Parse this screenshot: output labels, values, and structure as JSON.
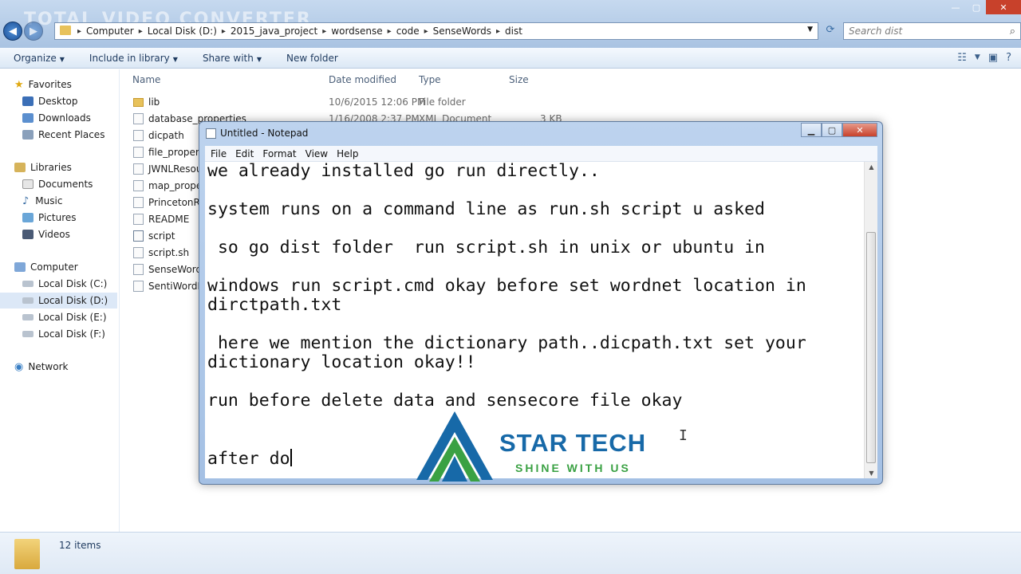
{
  "window": {
    "watermark": "TOTAL VIDEO CONVERTER",
    "controls": [
      "—",
      "▢",
      "✕"
    ]
  },
  "address_bar": {
    "segments": [
      "Computer",
      "Local Disk (D:)",
      "2015_java_project",
      "wordsense",
      "code",
      "SenseWords",
      "dist"
    ],
    "search_placeholder": "Search dist"
  },
  "toolbar": {
    "organize": "Organize",
    "include_in_library": "Include in library",
    "share_with": "Share with",
    "new_folder": "New folder"
  },
  "sidebar": {
    "favorites": "Favorites",
    "desktop": "Desktop",
    "downloads": "Downloads",
    "recent_places": "Recent Places",
    "libraries": "Libraries",
    "documents": "Documents",
    "music": "Music",
    "pictures": "Pictures",
    "videos": "Videos",
    "computer": "Computer",
    "local_c": "Local Disk (C:)",
    "local_d": "Local Disk (D:)",
    "local_e": "Local Disk (E:)",
    "local_f": "Local Disk (F:)",
    "network": "Network"
  },
  "file_list": {
    "columns": {
      "name": "Name",
      "date": "Date modified",
      "type": "Type",
      "size": "Size"
    },
    "rows": [
      {
        "name": "lib",
        "date": "10/6/2015 12:06 PM",
        "type": "File folder",
        "size": ""
      },
      {
        "name": "database_properties",
        "date": "1/16/2008 2:37 PM",
        "type": "XML Document",
        "size": "3 KB"
      },
      {
        "name": "dicpath",
        "date": "",
        "type": "",
        "size": ""
      },
      {
        "name": "file_properties",
        "date": "",
        "type": "",
        "size": ""
      },
      {
        "name": "JWNLResource",
        "date": "",
        "type": "",
        "size": ""
      },
      {
        "name": "map_properties",
        "date": "",
        "type": "",
        "size": ""
      },
      {
        "name": "PrincetonRes",
        "date": "",
        "type": "",
        "size": ""
      },
      {
        "name": "README",
        "date": "",
        "type": "",
        "size": ""
      },
      {
        "name": "script",
        "date": "",
        "type": "",
        "size": ""
      },
      {
        "name": "script.sh",
        "date": "",
        "type": "",
        "size": ""
      },
      {
        "name": "SenseWords",
        "date": "",
        "type": "",
        "size": ""
      },
      {
        "name": "SentiWordNet",
        "date": "",
        "type": "",
        "size": ""
      }
    ]
  },
  "status": {
    "item_count": "12 items"
  },
  "notepad": {
    "title": "Untitled - Notepad",
    "menu": [
      "File",
      "Edit",
      "Format",
      "View",
      "Help"
    ],
    "content": "we already installed go run directly..\n\nsystem runs on a command line as run.sh script u asked\n\n so go dist folder  run script.sh in unix or ubuntu in\n\nwindows run script.cmd okay before set wordnet location in\ndirctpath.txt\n\n here we mention the dictionary path..dicpath.txt set your\ndictionary location okay!!\n\nrun before delete data and sensecore file okay\n\n\nafter do"
  },
  "logo": {
    "title": "STAR TECH",
    "subtitle": "SHINE WITH US",
    "colors": {
      "blue": "#1769a8",
      "green": "#3aa143"
    }
  }
}
